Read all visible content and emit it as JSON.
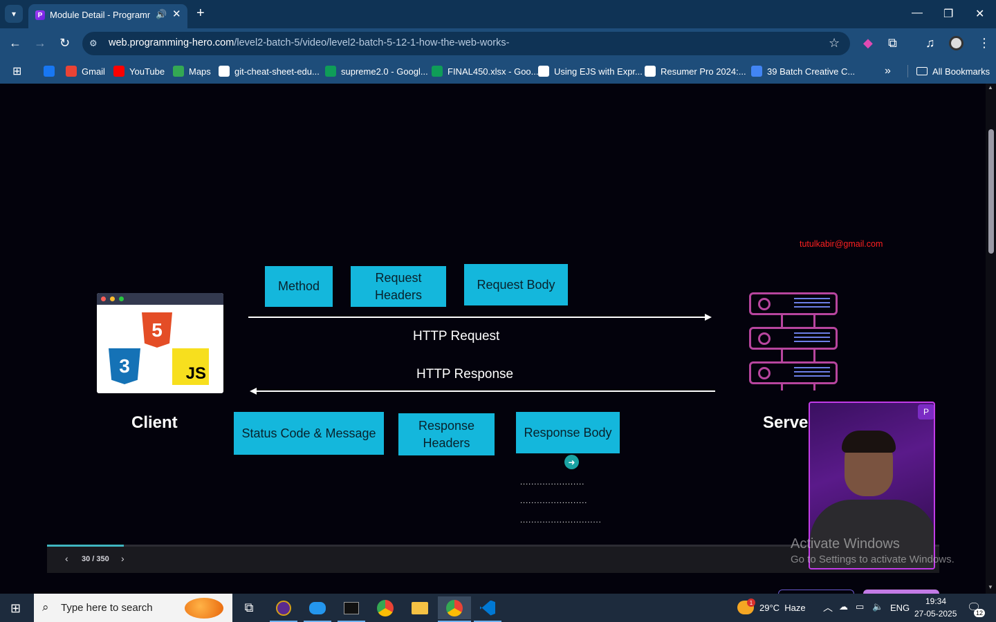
{
  "browser": {
    "tab_title": "Module Detail - Programming Hero",
    "url_host": "web.programming-hero.com",
    "url_path": "/level2-batch-5/video/level2-batch-5-12-1-how-the-web-works-",
    "bookmarks": [
      {
        "label": "",
        "icon": "facebook-icon",
        "color": "#1877f2"
      },
      {
        "label": "Gmail",
        "icon": "gmail-icon",
        "color": "#ea4335"
      },
      {
        "label": "YouTube",
        "icon": "youtube-icon",
        "color": "#ff0000"
      },
      {
        "label": "Maps",
        "icon": "maps-icon",
        "color": "#34a853"
      },
      {
        "label": "git-cheat-sheet-edu...",
        "icon": "github-icon",
        "color": "#ffffff"
      },
      {
        "label": "supreme2.0 - Googl...",
        "icon": "sheets-icon",
        "color": "#0f9d58"
      },
      {
        "label": "FINAL450.xlsx - Goo...",
        "icon": "sheets-icon",
        "color": "#0f9d58"
      },
      {
        "label": "Using EJS with Expr...",
        "icon": "github-icon",
        "color": "#ffffff"
      },
      {
        "label": "Resumer Pro 2024:...",
        "icon": "resumer-icon",
        "color": "#ffffff"
      },
      {
        "label": "39 Batch Creative C...",
        "icon": "docs-icon",
        "color": "#4285f4"
      }
    ],
    "all_bookmarks_label": "All Bookmarks"
  },
  "slide": {
    "email": "tutulkabir@gmail.com",
    "request_boxes": [
      "Method",
      "Request\nHeaders",
      "Request Body"
    ],
    "http_request": "HTTP Request",
    "http_response": "HTTP Response",
    "response_boxes": [
      "Status Code & Message",
      "Response\nHeaders",
      "Response Body"
    ],
    "client_label": "Client",
    "server_label": "Serve",
    "dots": [
      ".......................",
      "........................",
      "............................."
    ],
    "html_badge": "5",
    "css_badge": "3",
    "js_badge": "JS"
  },
  "player": {
    "page_count": "30 / 350",
    "progress": 0.0857
  },
  "watermark": {
    "line1": "Activate Windows",
    "line2": "Go to Settings to activate Windows."
  },
  "taskbar": {
    "search_placeholder": "Type here to search",
    "weather": "29°C  Haze",
    "weather_badge": "1",
    "lang": "ENG",
    "time": "19:34",
    "date": "27-05-2025",
    "notif_count": "12"
  },
  "colors": {
    "accent_box": "#14b7dc",
    "server_stroke": "#b7459e",
    "email": "#ff2020"
  }
}
